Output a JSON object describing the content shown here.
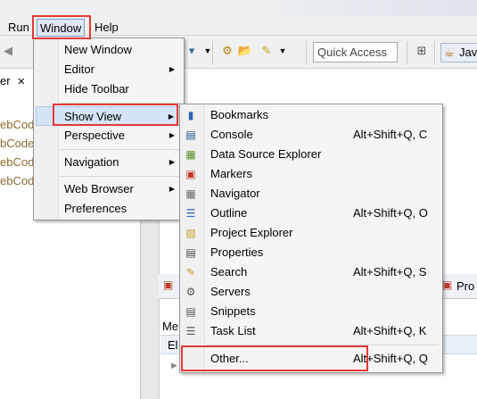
{
  "menubar": {
    "items": [
      {
        "label": "Run"
      },
      {
        "label": "Window"
      },
      {
        "label": "Help"
      }
    ]
  },
  "toolbar": {
    "quick_access": "Quick Access",
    "perspective_label": "Jav"
  },
  "left_view": {
    "tab_label": "er",
    "tree_items": [
      "ebCode",
      "bCodes",
      "ebCode",
      "ebCode"
    ]
  },
  "bottom_pane": {
    "tab_label": "Pro",
    "label_me": "Me",
    "label_el": "El"
  },
  "window_menu": {
    "items": [
      {
        "label": "New Window"
      },
      {
        "label": "Editor"
      },
      {
        "label": "Hide Toolbar"
      },
      {
        "label": "Show View"
      },
      {
        "label": "Perspective"
      },
      {
        "label": "Navigation"
      },
      {
        "label": "Web Browser"
      },
      {
        "label": "Preferences"
      }
    ]
  },
  "show_view_menu": {
    "items": [
      {
        "label": "Bookmarks",
        "accel": "",
        "icon": "bookmarks-icon"
      },
      {
        "label": "Console",
        "accel": "Alt+Shift+Q, C",
        "icon": "console-icon"
      },
      {
        "label": "Data Source Explorer",
        "accel": "",
        "icon": "data-source-icon"
      },
      {
        "label": "Markers",
        "accel": "",
        "icon": "markers-icon"
      },
      {
        "label": "Navigator",
        "accel": "",
        "icon": "navigator-icon"
      },
      {
        "label": "Outline",
        "accel": "Alt+Shift+Q, O",
        "icon": "outline-icon"
      },
      {
        "label": "Project Explorer",
        "accel": "",
        "icon": "project-explorer-icon"
      },
      {
        "label": "Properties",
        "accel": "",
        "icon": "properties-icon"
      },
      {
        "label": "Search",
        "accel": "Alt+Shift+Q, S",
        "icon": "search-icon"
      },
      {
        "label": "Servers",
        "accel": "",
        "icon": "servers-icon"
      },
      {
        "label": "Snippets",
        "accel": "",
        "icon": "snippets-icon"
      },
      {
        "label": "Task List",
        "accel": "Alt+Shift+Q, K",
        "icon": "task-list-icon"
      },
      {
        "label": "Other...",
        "accel": "Alt+Shift+Q, Q",
        "icon": ""
      }
    ]
  },
  "colors": {
    "highlight": "#d5e5f7",
    "annotation_red": "#e53935"
  }
}
